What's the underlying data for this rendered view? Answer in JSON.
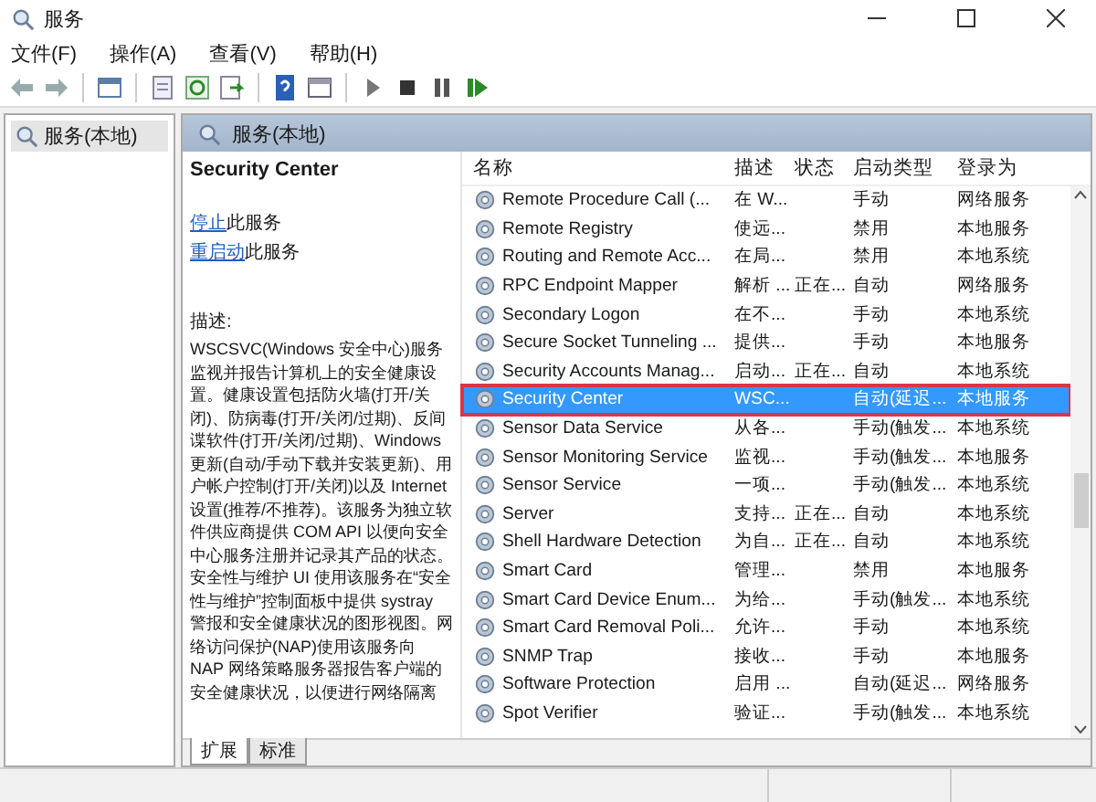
{
  "window": {
    "title": "服务"
  },
  "menu": [
    "文件(F)",
    "操作(A)",
    "查看(V)",
    "帮助(H)"
  ],
  "tree": [
    {
      "label": "服务(本地)",
      "selected": true
    }
  ],
  "panel_header": "服务(本地)",
  "detail": {
    "service_name": "Security Center",
    "actions": [
      {
        "link": "停止",
        "text": "此服务"
      },
      {
        "link": "重启动",
        "text": "此服务"
      }
    ],
    "description_label": "描述:",
    "description": "WSCSVC(Windows 安全中心)服务监视并报告计算机上的安全健康设置。健康设置包括防火墙(打开/关闭)、防病毒(打开/关闭/过期)、反间谍软件(打开/关闭/过期)、Windows 更新(自动/手动下载并安装更新)、用户帐户控制(打开/关闭)以及 Internet 设置(推荐/不推荐)。该服务为独立软件供应商提供 COM API 以便向安全中心服务注册并记录其产品的状态。安全性与维护 UI 使用该服务在“安全性与维护”控制面板中提供 systray 警报和安全健康状况的图形视图。网络访问保护(NAP)使用该服务向 NAP 网络策略服务器报告客户端的安全健康状况，以便进行网络隔离"
  },
  "table": {
    "columns": [
      "名称",
      "描述",
      "状态",
      "启动类型",
      "登录为"
    ],
    "rows": [
      {
        "name": "Remote Procedure Call (...",
        "description": "在 W...",
        "status": "",
        "startup": "手动",
        "logon": "网络服务",
        "selected": false
      },
      {
        "name": "Remote Registry",
        "description": "使远...",
        "status": "",
        "startup": "禁用",
        "logon": "本地服务",
        "selected": false
      },
      {
        "name": "Routing and Remote Acc...",
        "description": "在局...",
        "status": "",
        "startup": "禁用",
        "logon": "本地系统",
        "selected": false
      },
      {
        "name": "RPC Endpoint Mapper",
        "description": "解析 ...",
        "status": "正在...",
        "startup": "自动",
        "logon": "网络服务",
        "selected": false
      },
      {
        "name": "Secondary Logon",
        "description": "在不...",
        "status": "",
        "startup": "手动",
        "logon": "本地系统",
        "selected": false
      },
      {
        "name": "Secure Socket Tunneling ...",
        "description": "提供...",
        "status": "",
        "startup": "手动",
        "logon": "本地服务",
        "selected": false
      },
      {
        "name": "Security Accounts Manag...",
        "description": "启动...",
        "status": "正在...",
        "startup": "自动",
        "logon": "本地系统",
        "selected": false
      },
      {
        "name": "Security Center",
        "description": "WSC...",
        "status": "",
        "startup": "自动(延迟...",
        "logon": "本地服务",
        "selected": true
      },
      {
        "name": "Sensor Data Service",
        "description": "从各...",
        "status": "",
        "startup": "手动(触发...",
        "logon": "本地系统",
        "selected": false
      },
      {
        "name": "Sensor Monitoring Service",
        "description": "监视...",
        "status": "",
        "startup": "手动(触发...",
        "logon": "本地服务",
        "selected": false
      },
      {
        "name": "Sensor Service",
        "description": "一项...",
        "status": "",
        "startup": "手动(触发...",
        "logon": "本地系统",
        "selected": false
      },
      {
        "name": "Server",
        "description": "支持...",
        "status": "正在...",
        "startup": "自动",
        "logon": "本地系统",
        "selected": false
      },
      {
        "name": "Shell Hardware Detection",
        "description": "为自...",
        "status": "正在...",
        "startup": "自动",
        "logon": "本地系统",
        "selected": false
      },
      {
        "name": "Smart Card",
        "description": "管理...",
        "status": "",
        "startup": "禁用",
        "logon": "本地服务",
        "selected": false
      },
      {
        "name": "Smart Card Device Enum...",
        "description": "为给...",
        "status": "",
        "startup": "手动(触发...",
        "logon": "本地系统",
        "selected": false
      },
      {
        "name": "Smart Card Removal Poli...",
        "description": "允许...",
        "status": "",
        "startup": "手动",
        "logon": "本地系统",
        "selected": false
      },
      {
        "name": "SNMP Trap",
        "description": "接收...",
        "status": "",
        "startup": "手动",
        "logon": "本地服务",
        "selected": false
      },
      {
        "name": "Software Protection",
        "description": "启用 ...",
        "status": "",
        "startup": "自动(延迟...",
        "logon": "网络服务",
        "selected": false
      },
      {
        "name": "Spot Verifier",
        "description": "验证...",
        "status": "",
        "startup": "手动(触发...",
        "logon": "本地系统",
        "selected": false
      }
    ]
  },
  "tabs": [
    {
      "label": "扩展",
      "selected": true
    },
    {
      "label": "标准",
      "selected": false
    }
  ]
}
